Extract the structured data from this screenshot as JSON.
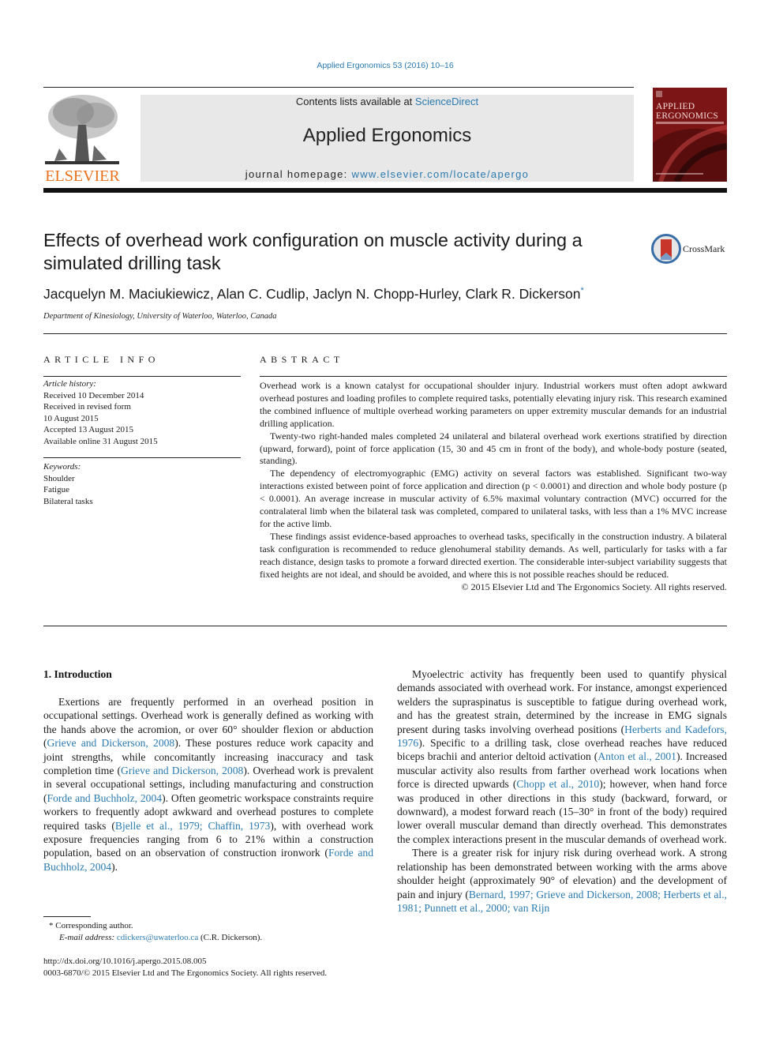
{
  "header": {
    "journal_ref": "Applied Ergonomics 53 (2016) 10–16",
    "contents_prefix": "Contents lists available at ",
    "contents_link": "ScienceDirect",
    "journal_title": "Applied Ergonomics",
    "homepage_prefix": "journal homepage: ",
    "homepage_link": "www.elsevier.com/locate/apergo",
    "publisher_logo_text": "ELSEVIER",
    "cover_title_line1": "APPLIED",
    "cover_title_line2": "ERGONOMICS"
  },
  "article": {
    "title": "Effects of overhead work configuration on muscle activity during a simulated drilling task",
    "crossmark_label": "CrossMark",
    "authors": "Jacquelyn M. Maciukiewicz, Alan C. Cudlip, Jaclyn N. Chopp-Hurley, Clark R. Dickerson",
    "author_marker": "*",
    "affiliation": "Department of Kinesiology, University of Waterloo, Waterloo, Canada"
  },
  "article_info": {
    "caption": "ARTICLE INFO",
    "history_label": "Article history:",
    "history": [
      "Received 10 December 2014",
      "Received in revised form",
      "10 August 2015",
      "Accepted 13 August 2015",
      "Available online 31 August 2015"
    ],
    "keywords_label": "Keywords:",
    "keywords": [
      "Shoulder",
      "Fatigue",
      "Bilateral tasks"
    ]
  },
  "abstract": {
    "caption": "ABSTRACT",
    "paragraphs": [
      "Overhead work is a known catalyst for occupational shoulder injury. Industrial workers must often adopt awkward overhead postures and loading profiles to complete required tasks, potentially elevating injury risk. This research examined the combined influence of multiple overhead working parameters on upper extremity muscular demands for an industrial drilling application.",
      "Twenty-two right-handed males completed 24 unilateral and bilateral overhead work exertions stratified by direction (upward, forward), point of force application (15, 30 and 45 cm in front of the body), and whole-body posture (seated, standing).",
      "The dependency of electromyographic (EMG) activity on several factors was established. Significant two-way interactions existed between point of force application and direction (p < 0.0001) and direction and whole body posture (p < 0.0001). An average increase in muscular activity of 6.5% maximal voluntary contraction (MVC) occurred for the contralateral limb when the bilateral task was completed, compared to unilateral tasks, with less than a 1% MVC increase for the active limb.",
      "These findings assist evidence-based approaches to overhead tasks, specifically in the construction industry. A bilateral task configuration is recommended to reduce glenohumeral stability demands. As well, particularly for tasks with a far reach distance, design tasks to promote a forward directed exertion. The considerable inter-subject variability suggests that fixed heights are not ideal, and should be avoided, and where this is not possible reaches should be reduced."
    ],
    "copyright": "© 2015 Elsevier Ltd and The Ergonomics Society. All rights reserved."
  },
  "body": {
    "section_heading": "1.  Introduction",
    "left_para": {
      "t1": "Exertions are frequently performed in an overhead position in occupational settings. Overhead work is generally defined as working with the hands above the acromion, or over 60° shoulder flexion or abduction (",
      "c1": "Grieve and Dickerson, 2008",
      "t2": "). These postures reduce work capacity and joint strengths, while concomitantly increasing inaccuracy and task completion time (",
      "c2": "Grieve and Dickerson, 2008",
      "t3": "). Overhead work is prevalent in several occupational settings, including manufacturing and construction (",
      "c3": "Forde and Buchholz, 2004",
      "t4": "). Often geometric workspace constraints require workers to frequently adopt awkward and overhead postures to complete required tasks (",
      "c4": "Bjelle et al., 1979; Chaffin, 1973",
      "t5": "), with overhead work exposure frequencies ranging from 6 to 21% within a construction population, based on an observation of construction ironwork (",
      "c5": "Forde and Buchholz, 2004",
      "t6": ")."
    },
    "right_para1": {
      "t1": "Myoelectric activity has frequently been used to quantify physical demands associated with overhead work. For instance, amongst experienced welders the supraspinatus is susceptible to fatigue during overhead work, and has the greatest strain, determined by the increase in EMG signals present during tasks involving overhead positions (",
      "c1": "Herberts and Kadefors, 1976",
      "t2": "). Specific to a drilling task, close overhead reaches have reduced biceps brachii and anterior deltoid activation (",
      "c2": "Anton et al., 2001",
      "t3": "). Increased muscular activity also results from farther overhead work locations when force is directed upwards (",
      "c3": "Chopp et al., 2010",
      "t4": "); however, when hand force was produced in other directions in this study (backward, forward, or downward), a modest forward reach (15–30° in front of the body) required lower overall muscular demand than directly overhead. This demonstrates the complex interactions present in the muscular demands of overhead work."
    },
    "right_para2": {
      "t1": "There is a greater risk for injury risk during overhead work. A strong relationship has been demonstrated between working with the arms above shoulder height (approximately 90° of elevation) and the development of pain and injury (",
      "c1": "Bernard, 1997; Grieve and Dickerson, 2008; Herberts et al., 1981; Punnett et al., 2000; van Rijn"
    }
  },
  "footnotes": {
    "corresponding": "* Corresponding author.",
    "email_label": "E-mail address: ",
    "email": "cdickers@uwaterloo.ca",
    "email_suffix": " (C.R. Dickerson).",
    "doi": "http://dx.doi.org/10.1016/j.apergo.2015.08.005",
    "issn": "0003-6870/© 2015 Elsevier Ltd and The Ergonomics Society. All rights reserved."
  }
}
